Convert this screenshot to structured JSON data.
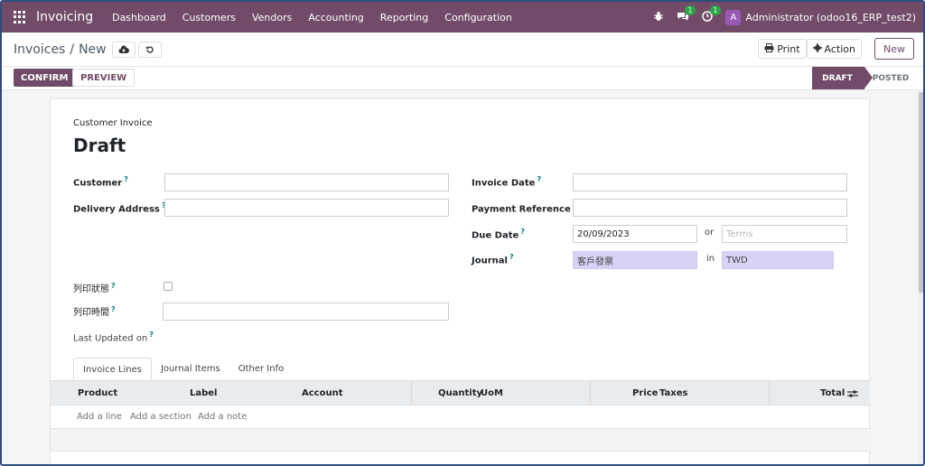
{
  "navbar": {
    "app_name": "Invoicing",
    "menu": [
      "Dashboard",
      "Customers",
      "Vendors",
      "Accounting",
      "Reporting",
      "Configuration"
    ],
    "bug_icon": "bug-icon",
    "messages_badge": "1",
    "activity_badge": "1",
    "avatar_letter": "A",
    "user": "Administrator (odoo16_ERP_test2)"
  },
  "breadcrumb": {
    "parent": "Invoices",
    "separator": "/",
    "current": "New"
  },
  "toolbar": {
    "print": "Print",
    "action": "Action",
    "new": "New"
  },
  "statusbar": {
    "confirm": "CONFIRM",
    "preview": "PREVIEW",
    "stages": [
      "DRAFT",
      "POSTED"
    ],
    "active_stage": "DRAFT"
  },
  "form": {
    "type_label": "Customer Invoice",
    "title": "Draft",
    "help_mark": "?",
    "fields": {
      "customer": {
        "label": "Customer",
        "value": ""
      },
      "delivery_address": {
        "label": "Delivery Address",
        "value": ""
      },
      "print_status": {
        "label": "列印狀態"
      },
      "print_time": {
        "label": "列印時間",
        "value": ""
      },
      "last_updated": {
        "label": "Last Updated on"
      },
      "invoice_date": {
        "label": "Invoice Date",
        "value": ""
      },
      "payment_reference": {
        "label": "Payment Reference",
        "value": ""
      },
      "due_date": {
        "label": "Due Date",
        "value": "20/09/2023",
        "or": "or",
        "terms_placeholder": "Terms"
      },
      "journal": {
        "label": "Journal",
        "value": "客戶發票",
        "in": "in",
        "currency": "TWD"
      }
    }
  },
  "tabs": [
    "Invoice Lines",
    "Journal Items",
    "Other Info"
  ],
  "table": {
    "columns": [
      "Product",
      "Label",
      "Account",
      "Quantity",
      "UoM",
      "Price",
      "Taxes",
      "Total"
    ],
    "add_links": [
      "Add a line",
      "Add a section",
      "Add a note"
    ]
  },
  "colors": {
    "brand": "#714b67",
    "badge": "#28a745",
    "filled_field": "#d8d2f5",
    "help": "#017e84"
  }
}
